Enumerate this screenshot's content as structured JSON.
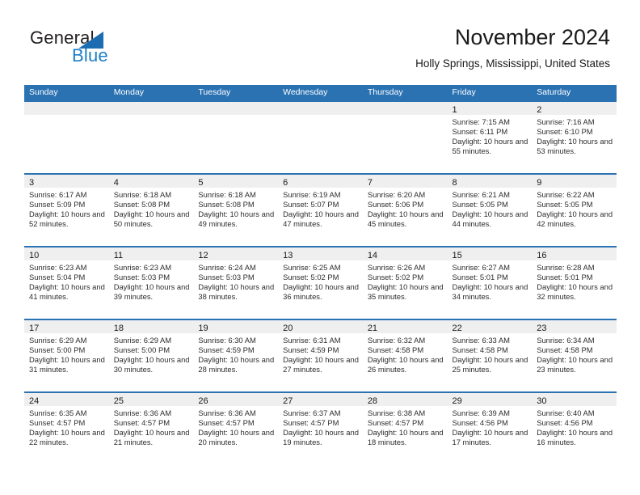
{
  "brand": {
    "name_part1": "General",
    "name_part2": "Blue",
    "accent_color": "#1d7ec8",
    "triangle_color": "#1b6cb0"
  },
  "header": {
    "title": "November 2024",
    "location": "Holly Springs, Mississippi, United States"
  },
  "theme": {
    "header_bar_color": "#2b72b3",
    "daynum_band_color": "#efefef",
    "cell_background": "#ffffff",
    "text_color": "#2d2d2d"
  },
  "weekdays": [
    "Sunday",
    "Monday",
    "Tuesday",
    "Wednesday",
    "Thursday",
    "Friday",
    "Saturday"
  ],
  "weeks": [
    [
      {
        "day": "",
        "sunrise": "",
        "sunset": "",
        "daylight": "",
        "empty": true
      },
      {
        "day": "",
        "sunrise": "",
        "sunset": "",
        "daylight": "",
        "empty": true
      },
      {
        "day": "",
        "sunrise": "",
        "sunset": "",
        "daylight": "",
        "empty": true
      },
      {
        "day": "",
        "sunrise": "",
        "sunset": "",
        "daylight": "",
        "empty": true
      },
      {
        "day": "",
        "sunrise": "",
        "sunset": "",
        "daylight": "",
        "empty": true
      },
      {
        "day": "1",
        "sunrise": "Sunrise: 7:15 AM",
        "sunset": "Sunset: 6:11 PM",
        "daylight": "Daylight: 10 hours and 55 minutes."
      },
      {
        "day": "2",
        "sunrise": "Sunrise: 7:16 AM",
        "sunset": "Sunset: 6:10 PM",
        "daylight": "Daylight: 10 hours and 53 minutes."
      }
    ],
    [
      {
        "day": "3",
        "sunrise": "Sunrise: 6:17 AM",
        "sunset": "Sunset: 5:09 PM",
        "daylight": "Daylight: 10 hours and 52 minutes."
      },
      {
        "day": "4",
        "sunrise": "Sunrise: 6:18 AM",
        "sunset": "Sunset: 5:08 PM",
        "daylight": "Daylight: 10 hours and 50 minutes."
      },
      {
        "day": "5",
        "sunrise": "Sunrise: 6:18 AM",
        "sunset": "Sunset: 5:08 PM",
        "daylight": "Daylight: 10 hours and 49 minutes."
      },
      {
        "day": "6",
        "sunrise": "Sunrise: 6:19 AM",
        "sunset": "Sunset: 5:07 PM",
        "daylight": "Daylight: 10 hours and 47 minutes."
      },
      {
        "day": "7",
        "sunrise": "Sunrise: 6:20 AM",
        "sunset": "Sunset: 5:06 PM",
        "daylight": "Daylight: 10 hours and 45 minutes."
      },
      {
        "day": "8",
        "sunrise": "Sunrise: 6:21 AM",
        "sunset": "Sunset: 5:05 PM",
        "daylight": "Daylight: 10 hours and 44 minutes."
      },
      {
        "day": "9",
        "sunrise": "Sunrise: 6:22 AM",
        "sunset": "Sunset: 5:05 PM",
        "daylight": "Daylight: 10 hours and 42 minutes."
      }
    ],
    [
      {
        "day": "10",
        "sunrise": "Sunrise: 6:23 AM",
        "sunset": "Sunset: 5:04 PM",
        "daylight": "Daylight: 10 hours and 41 minutes."
      },
      {
        "day": "11",
        "sunrise": "Sunrise: 6:23 AM",
        "sunset": "Sunset: 5:03 PM",
        "daylight": "Daylight: 10 hours and 39 minutes."
      },
      {
        "day": "12",
        "sunrise": "Sunrise: 6:24 AM",
        "sunset": "Sunset: 5:03 PM",
        "daylight": "Daylight: 10 hours and 38 minutes."
      },
      {
        "day": "13",
        "sunrise": "Sunrise: 6:25 AM",
        "sunset": "Sunset: 5:02 PM",
        "daylight": "Daylight: 10 hours and 36 minutes."
      },
      {
        "day": "14",
        "sunrise": "Sunrise: 6:26 AM",
        "sunset": "Sunset: 5:02 PM",
        "daylight": "Daylight: 10 hours and 35 minutes."
      },
      {
        "day": "15",
        "sunrise": "Sunrise: 6:27 AM",
        "sunset": "Sunset: 5:01 PM",
        "daylight": "Daylight: 10 hours and 34 minutes."
      },
      {
        "day": "16",
        "sunrise": "Sunrise: 6:28 AM",
        "sunset": "Sunset: 5:01 PM",
        "daylight": "Daylight: 10 hours and 32 minutes."
      }
    ],
    [
      {
        "day": "17",
        "sunrise": "Sunrise: 6:29 AM",
        "sunset": "Sunset: 5:00 PM",
        "daylight": "Daylight: 10 hours and 31 minutes."
      },
      {
        "day": "18",
        "sunrise": "Sunrise: 6:29 AM",
        "sunset": "Sunset: 5:00 PM",
        "daylight": "Daylight: 10 hours and 30 minutes."
      },
      {
        "day": "19",
        "sunrise": "Sunrise: 6:30 AM",
        "sunset": "Sunset: 4:59 PM",
        "daylight": "Daylight: 10 hours and 28 minutes."
      },
      {
        "day": "20",
        "sunrise": "Sunrise: 6:31 AM",
        "sunset": "Sunset: 4:59 PM",
        "daylight": "Daylight: 10 hours and 27 minutes."
      },
      {
        "day": "21",
        "sunrise": "Sunrise: 6:32 AM",
        "sunset": "Sunset: 4:58 PM",
        "daylight": "Daylight: 10 hours and 26 minutes."
      },
      {
        "day": "22",
        "sunrise": "Sunrise: 6:33 AM",
        "sunset": "Sunset: 4:58 PM",
        "daylight": "Daylight: 10 hours and 25 minutes."
      },
      {
        "day": "23",
        "sunrise": "Sunrise: 6:34 AM",
        "sunset": "Sunset: 4:58 PM",
        "daylight": "Daylight: 10 hours and 23 minutes."
      }
    ],
    [
      {
        "day": "24",
        "sunrise": "Sunrise: 6:35 AM",
        "sunset": "Sunset: 4:57 PM",
        "daylight": "Daylight: 10 hours and 22 minutes."
      },
      {
        "day": "25",
        "sunrise": "Sunrise: 6:36 AM",
        "sunset": "Sunset: 4:57 PM",
        "daylight": "Daylight: 10 hours and 21 minutes."
      },
      {
        "day": "26",
        "sunrise": "Sunrise: 6:36 AM",
        "sunset": "Sunset: 4:57 PM",
        "daylight": "Daylight: 10 hours and 20 minutes."
      },
      {
        "day": "27",
        "sunrise": "Sunrise: 6:37 AM",
        "sunset": "Sunset: 4:57 PM",
        "daylight": "Daylight: 10 hours and 19 minutes."
      },
      {
        "day": "28",
        "sunrise": "Sunrise: 6:38 AM",
        "sunset": "Sunset: 4:57 PM",
        "daylight": "Daylight: 10 hours and 18 minutes."
      },
      {
        "day": "29",
        "sunrise": "Sunrise: 6:39 AM",
        "sunset": "Sunset: 4:56 PM",
        "daylight": "Daylight: 10 hours and 17 minutes."
      },
      {
        "day": "30",
        "sunrise": "Sunrise: 6:40 AM",
        "sunset": "Sunset: 4:56 PM",
        "daylight": "Daylight: 10 hours and 16 minutes."
      }
    ]
  ]
}
